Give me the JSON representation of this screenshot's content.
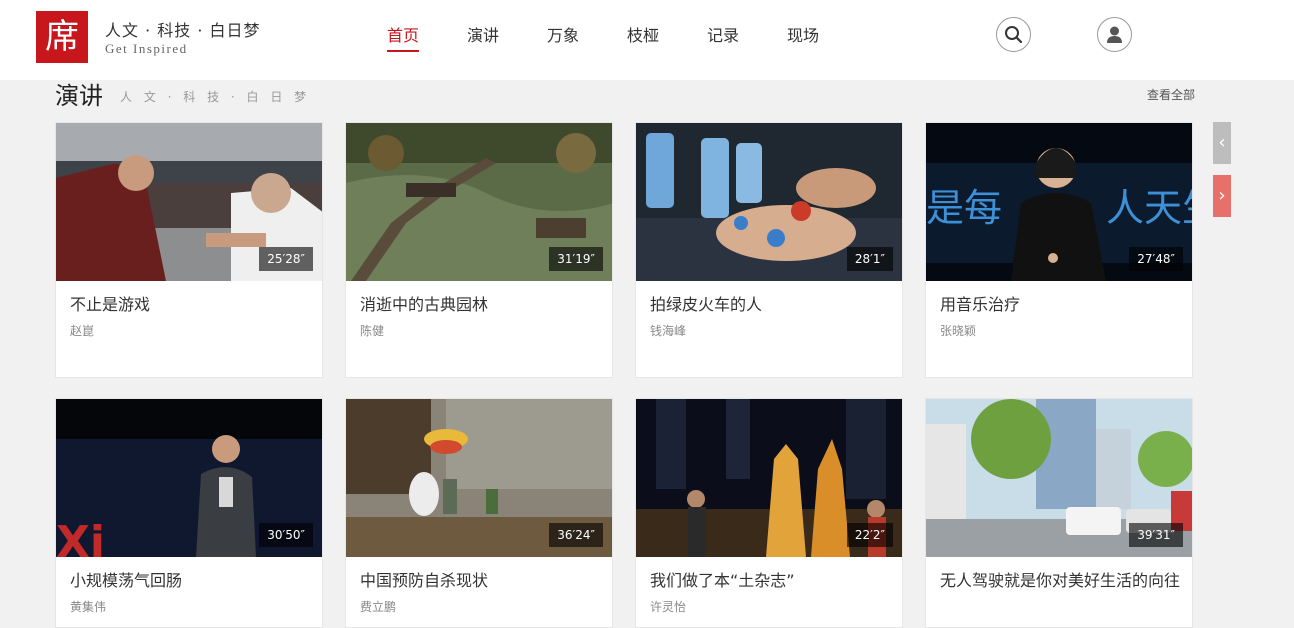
{
  "header": {
    "logo_char": "席",
    "slogan": "人文 · 科技 · 白日梦",
    "tagline": "Get Inspired",
    "nav": [
      {
        "label": "首页",
        "active": true
      },
      {
        "label": "演讲"
      },
      {
        "label": "万象"
      },
      {
        "label": "枝桠"
      },
      {
        "label": "记录"
      },
      {
        "label": "现场"
      }
    ],
    "search_icon": "search-icon",
    "user_icon": "user-icon",
    "accent_color": "#c8161d"
  },
  "section": {
    "title": "演讲",
    "subtitle": "人 文 · 科 技 · 白 日 梦",
    "view_all": "查看全部"
  },
  "slider": {
    "prev_icon": "chevron-left-icon",
    "next_icon": "chevron-right-icon",
    "prev_glyph": "‹",
    "next_glyph": "›"
  },
  "cards": [
    {
      "title": "不止是游戏",
      "author": "赵崑",
      "duration": "25′28″"
    },
    {
      "title": "消逝中的古典园林",
      "author": "陈健",
      "duration": "31′19″"
    },
    {
      "title": "拍绿皮火车的人",
      "author": "钱海峰",
      "duration": "28′1″"
    },
    {
      "title": "用音乐治疗",
      "author": "张晓颖",
      "duration": "27′48″"
    },
    {
      "title": "小规模荡气回肠",
      "author": "黄集伟",
      "duration": "30′50″"
    },
    {
      "title": "中国预防自杀现状",
      "author": "费立鹏",
      "duration": "36′24″"
    },
    {
      "title": "我们做了本“土杂志”",
      "author": "许灵怡",
      "duration": "22′2″"
    },
    {
      "title": "无人驾驶就是你对美好生活的向往",
      "author": "",
      "duration": "39′31″"
    }
  ]
}
